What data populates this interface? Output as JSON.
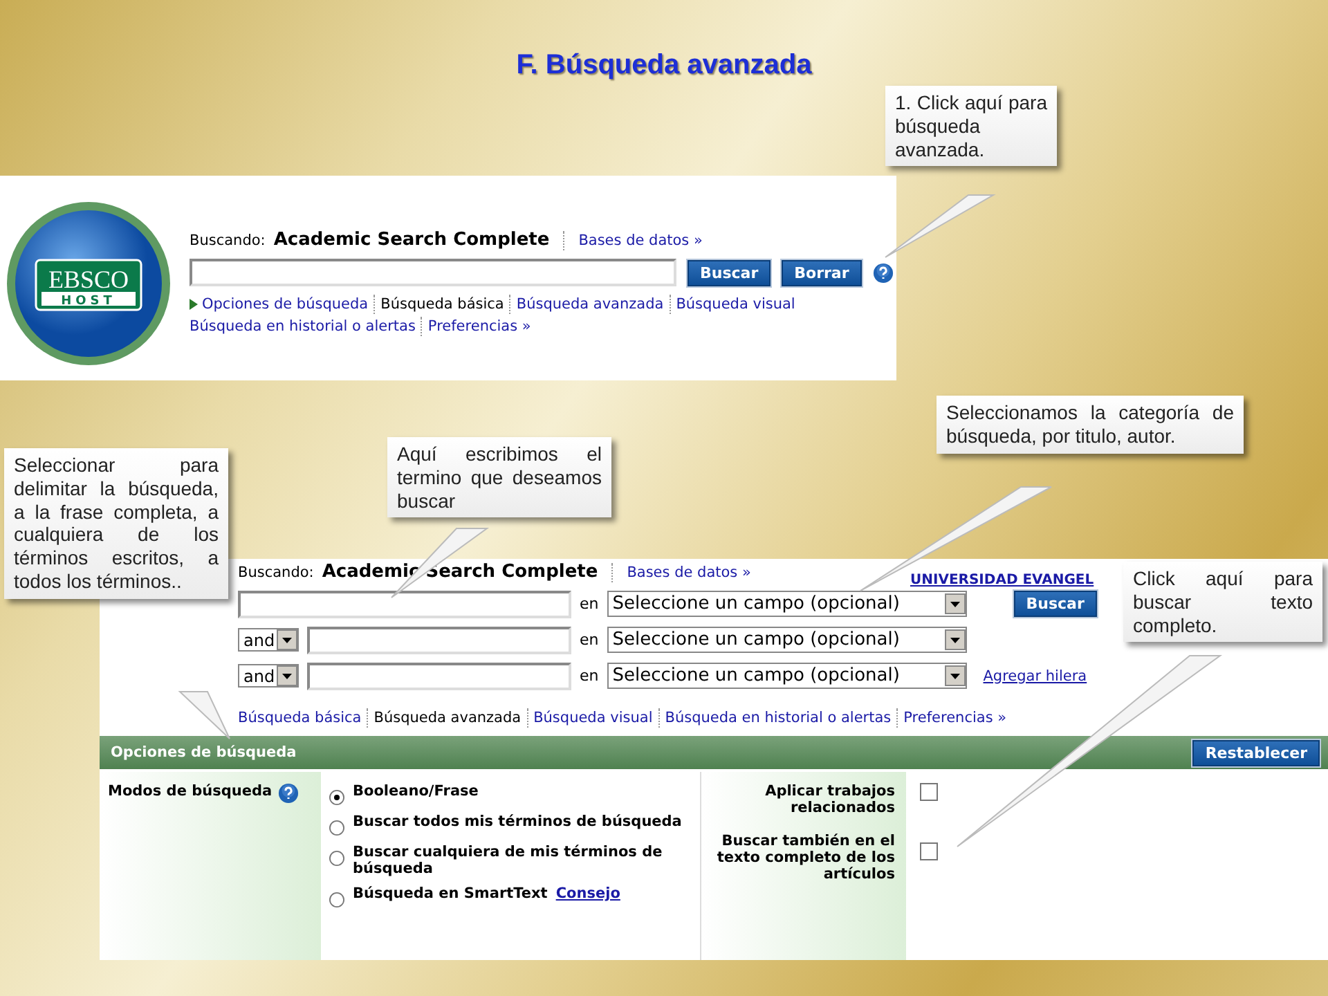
{
  "title": "F. Búsqueda avanzada",
  "basic_panel": {
    "logo": {
      "top": "EBSCO",
      "bottom": "HOST"
    },
    "searching_label": "Buscando:",
    "database": "Academic Search Complete",
    "databases_link": "Bases de datos »",
    "buttons": [
      "Buscar",
      "Borrar"
    ],
    "nav": [
      {
        "label": "Opciones de búsqueda",
        "kind": "expander",
        "selected": false
      },
      {
        "label": "Búsqueda básica",
        "kind": "link",
        "selected": true
      },
      {
        "label": "Búsqueda avanzada",
        "kind": "link",
        "selected": false
      },
      {
        "label": "Búsqueda visual",
        "kind": "link",
        "selected": false
      },
      {
        "label": "Búsqueda en historial o alertas",
        "kind": "link",
        "selected": false
      },
      {
        "label": "Preferencias »",
        "kind": "link",
        "selected": false
      }
    ]
  },
  "advanced_panel": {
    "searching_label": "Buscando:",
    "database": "Academic Search Complete",
    "databases_link": "Bases de datos »",
    "institution": "UNIVERSIDAD EVANGEL",
    "rows": [
      {
        "field": "Seleccione un campo (opcional)",
        "in": "en",
        "search_button": "Buscar"
      },
      {
        "operator": "and",
        "field": "Seleccione un campo (opcional)",
        "in": "en"
      },
      {
        "operator": "and",
        "field": "Seleccione un campo (opcional)",
        "in": "en",
        "add_link": "Agregar hilera"
      }
    ],
    "nav": [
      {
        "label": "Búsqueda básica",
        "selected": false
      },
      {
        "label": "Búsqueda avanzada",
        "selected": true
      },
      {
        "label": "Búsqueda visual",
        "selected": false
      },
      {
        "label": "Búsqueda en historial o alertas",
        "selected": false
      },
      {
        "label": "Preferencias »",
        "selected": false
      }
    ],
    "options_title": "Opciones de búsqueda",
    "reset_button": "Restablecer",
    "modes_label": "Modos de búsqueda",
    "modes": [
      {
        "label": "Booleano/Frase",
        "selected": true
      },
      {
        "label": "Buscar todos mis términos de búsqueda",
        "selected": false
      },
      {
        "label": "Buscar cualquiera de mis términos de búsqueda",
        "selected": false
      },
      {
        "label": "Búsqueda en SmartText",
        "link": "Consejo",
        "selected": false
      }
    ],
    "limiters": [
      {
        "label": "Aplicar trabajos relacionados",
        "checked": false
      },
      {
        "label": "Buscar también en el texto completo de los artículos",
        "checked": false
      }
    ]
  },
  "callouts": [
    {
      "text": "1. Click aquí para búsqueda avanzada."
    },
    {
      "text": "Seleccionamos la categoría de búsqueda, por titulo, autor."
    },
    {
      "text": "Seleccionar para delimitar la búsqueda, a la frase completa, a cualquiera de los términos escritos, a todos los términos.."
    },
    {
      "text": "Aquí escribimos el termino que deseamos buscar"
    },
    {
      "text": "Click aquí para buscar texto completo."
    }
  ]
}
